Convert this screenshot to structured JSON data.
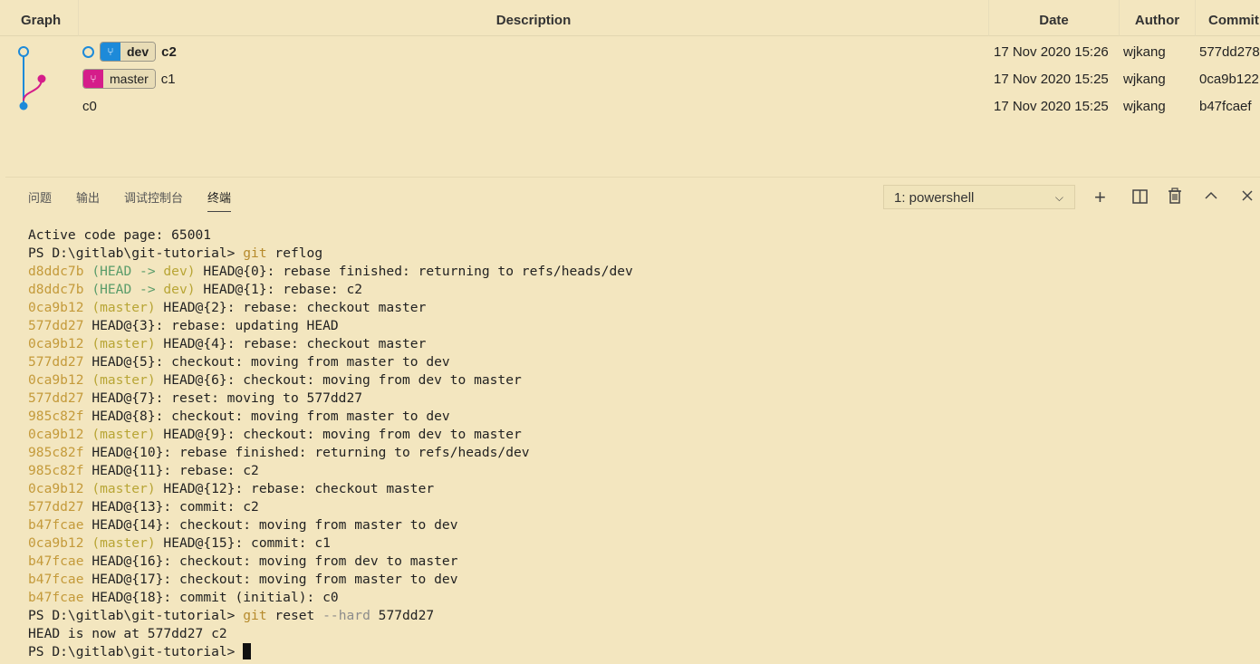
{
  "graph": {
    "headers": {
      "graph": "Graph",
      "description": "Description",
      "date": "Date",
      "author": "Author",
      "commit": "Commit"
    },
    "rows": [
      {
        "branch": "dev",
        "message": "c2",
        "date": "17 Nov 2020 15:26",
        "author": "wjkang",
        "commit": "577dd278"
      },
      {
        "branch": "master",
        "message": "c1",
        "date": "17 Nov 2020 15:25",
        "author": "wjkang",
        "commit": "0ca9b122"
      },
      {
        "branch": "",
        "message": "c0",
        "date": "17 Nov 2020 15:25",
        "author": "wjkang",
        "commit": "b47fcaef"
      }
    ],
    "colors": {
      "dev": "#1d8ad9",
      "master": "#d51d8a"
    }
  },
  "panel": {
    "tabs": [
      "问题",
      "输出",
      "调试控制台",
      "终端"
    ],
    "active_tab": "终端",
    "terminal_select": "1: powershell",
    "icons": [
      "plus-icon",
      "split-icon",
      "trash-icon",
      "chevron-up-icon",
      "close-icon"
    ]
  },
  "terminal": {
    "active_code_page": "Active code page: 65001",
    "prompt": "PS D:\\gitlab\\git-tutorial>",
    "cmd1_git": "git",
    "cmd1_rest": "reflog",
    "reflog": [
      {
        "hash": "d8ddc7b",
        "deco": "(HEAD -> dev)",
        "text": "HEAD@{0}: rebase finished: returning to refs/heads/dev"
      },
      {
        "hash": "d8ddc7b",
        "deco": "(HEAD -> dev)",
        "text": "HEAD@{1}: rebase: c2"
      },
      {
        "hash": "0ca9b12",
        "deco": "(master)",
        "text": "HEAD@{2}: rebase: checkout master"
      },
      {
        "hash": "577dd27",
        "deco": "",
        "text": "HEAD@{3}: rebase: updating HEAD"
      },
      {
        "hash": "0ca9b12",
        "deco": "(master)",
        "text": "HEAD@{4}: rebase: checkout master"
      },
      {
        "hash": "577dd27",
        "deco": "",
        "text": "HEAD@{5}: checkout: moving from master to dev"
      },
      {
        "hash": "0ca9b12",
        "deco": "(master)",
        "text": "HEAD@{6}: checkout: moving from dev to master"
      },
      {
        "hash": "577dd27",
        "deco": "",
        "text": "HEAD@{7}: reset: moving to 577dd27"
      },
      {
        "hash": "985c82f",
        "deco": "",
        "text": "HEAD@{8}: checkout: moving from master to dev"
      },
      {
        "hash": "0ca9b12",
        "deco": "(master)",
        "text": "HEAD@{9}: checkout: moving from dev to master"
      },
      {
        "hash": "985c82f",
        "deco": "",
        "text": "HEAD@{10}: rebase finished: returning to refs/heads/dev"
      },
      {
        "hash": "985c82f",
        "deco": "",
        "text": "HEAD@{11}: rebase: c2"
      },
      {
        "hash": "0ca9b12",
        "deco": "(master)",
        "text": "HEAD@{12}: rebase: checkout master"
      },
      {
        "hash": "577dd27",
        "deco": "",
        "text": "HEAD@{13}: commit: c2"
      },
      {
        "hash": "b47fcae",
        "deco": "",
        "text": "HEAD@{14}: checkout: moving from master to dev"
      },
      {
        "hash": "0ca9b12",
        "deco": "(master)",
        "text": "HEAD@{15}: commit: c1"
      },
      {
        "hash": "b47fcae",
        "deco": "",
        "text": "HEAD@{16}: checkout: moving from dev to master"
      },
      {
        "hash": "b47fcae",
        "deco": "",
        "text": "HEAD@{17}: checkout: moving from master to dev"
      },
      {
        "hash": "b47fcae",
        "deco": "",
        "text": "HEAD@{18}: commit (initial): c0"
      }
    ],
    "cmd2_git": "git",
    "cmd2_reset": "reset",
    "cmd2_flag": "--hard",
    "cmd2_arg": "577dd27",
    "reset_output": "HEAD is now at 577dd27 c2"
  }
}
